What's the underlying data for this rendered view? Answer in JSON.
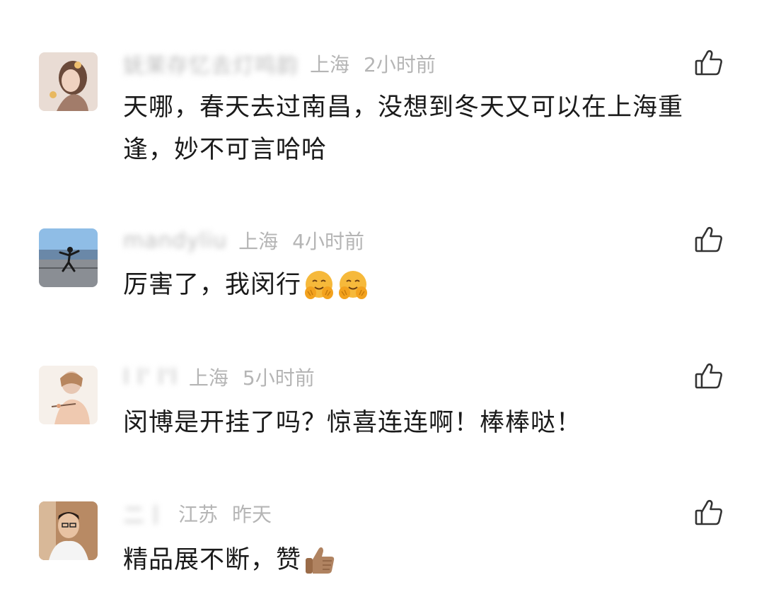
{
  "comments": [
    {
      "username": "妩茉存忆去灯鸣韵",
      "location": "上海",
      "time": "2小时前",
      "text": "天哪，春天去过南昌，没想到冬天又可以在上海重逢，妙不可言哈哈",
      "emoji": []
    },
    {
      "username": "mandyliu",
      "location": "上海",
      "time": "4小时前",
      "text": "厉害了，我闵行",
      "emoji": [
        "hug-emoji",
        "hug-emoji"
      ]
    },
    {
      "username": "l l' l'l",
      "location": "上海",
      "time": "5小时前",
      "text": "闵博是开挂了吗？惊喜连连啊！棒棒哒！",
      "emoji": []
    },
    {
      "username": "二丨",
      "location": "江苏",
      "time": "昨天",
      "text": "精品展不断，赞",
      "emoji": [
        "thumbs-up-emoji"
      ]
    }
  ],
  "icons": {
    "like": "thumbs-up-outline-icon"
  },
  "colors": {
    "meta_text": "#b5b5b5",
    "body_text": "#1a1a1a",
    "icon_stroke": "#333333",
    "emoji_yellow": "#f6b93b",
    "emoji_skin": "#b08361"
  }
}
